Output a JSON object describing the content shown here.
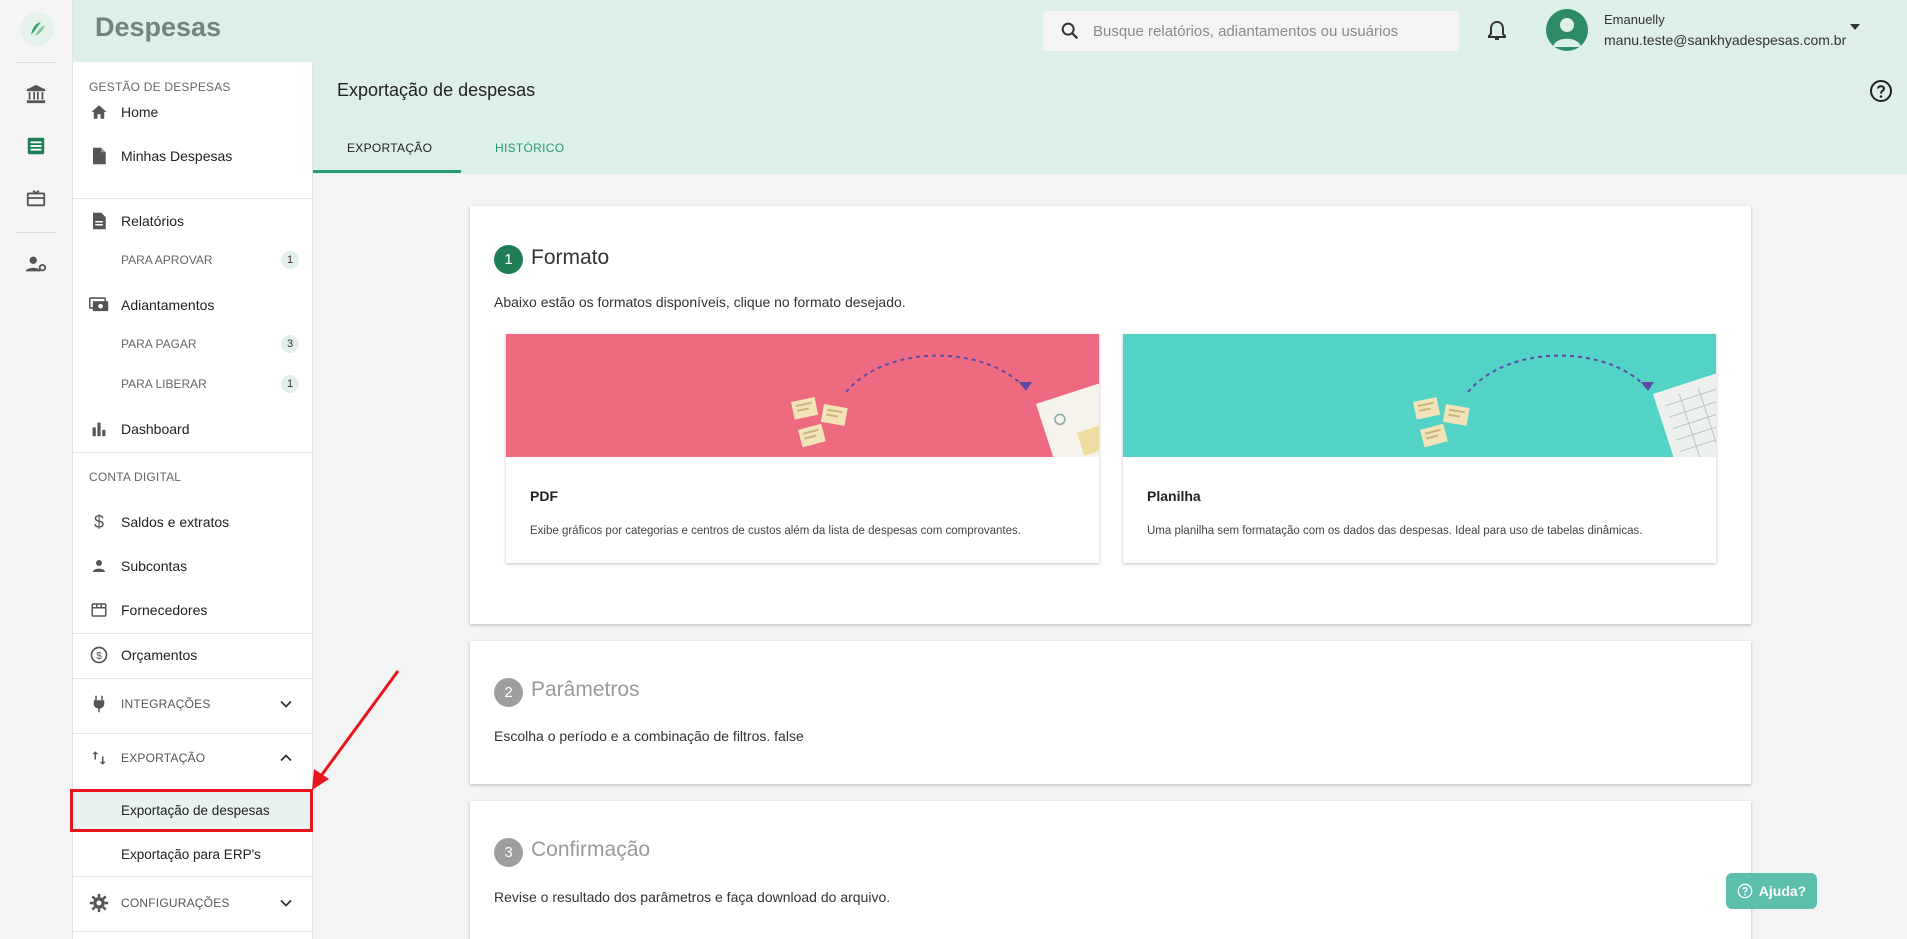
{
  "app": {
    "brand": "Despesas"
  },
  "header": {
    "search_placeholder": "Busque relatórios, adiantamentos ou usuários",
    "user_name": "Emanuelly",
    "user_email": "manu.teste@sankhyadespesas.com.br"
  },
  "sidebar": {
    "section_gestao": "GESTÃO DE DESPESAS",
    "home": "Home",
    "minhas_despesas": "Minhas Despesas",
    "relatorios": "Relatórios",
    "para_aprovar": "PARA APROVAR",
    "para_aprovar_count": "1",
    "adiantamentos": "Adiantamentos",
    "para_pagar": "PARA PAGAR",
    "para_pagar_count": "3",
    "para_liberar": "PARA LIBERAR",
    "para_liberar_count": "1",
    "dashboard": "Dashboard",
    "section_conta": "CONTA DIGITAL",
    "saldos": "Saldos e extratos",
    "subcontas": "Subcontas",
    "fornecedores": "Fornecedores",
    "orcamentos": "Orçamentos",
    "integracoes": "INTEGRAÇÕES",
    "exportacao": "EXPORTAÇÃO",
    "exportacao_despesas": "Exportação de despesas",
    "exportacao_erp": "Exportação para ERP's",
    "configuracoes": "CONFIGURAÇÕES"
  },
  "page": {
    "title": "Exportação de despesas",
    "tabs": [
      {
        "label": "EXPORTAÇÃO",
        "active": true
      },
      {
        "label": "HISTÓRICO",
        "active": false
      }
    ]
  },
  "steps": [
    {
      "number": "1",
      "title": "Formato",
      "description": "Abaixo estão os formatos disponíveis, clique no formato desejado.",
      "color": "#1e7d55"
    },
    {
      "number": "2",
      "title": "Parâmetros",
      "description": "Escolha o período e a combinação de filtros. false",
      "color": "#9e9e9e"
    },
    {
      "number": "3",
      "title": "Confirmação",
      "description": "Revise o resultado dos parâmetros e faça download do arquivo.",
      "color": "#9e9e9e"
    }
  ],
  "formats": [
    {
      "title": "PDF",
      "description": "Exibe gráficos por categorias e centros de custos além da lista de despesas com comprovantes.",
      "banner_color": "#ee6a80"
    },
    {
      "title": "Planilha",
      "description": "Uma planilha sem formatação com os dados das despesas. Ideal para uso de tabelas dinâmicas.",
      "banner_color": "#52d3c6"
    }
  ],
  "help_button": "Ajuda?"
}
